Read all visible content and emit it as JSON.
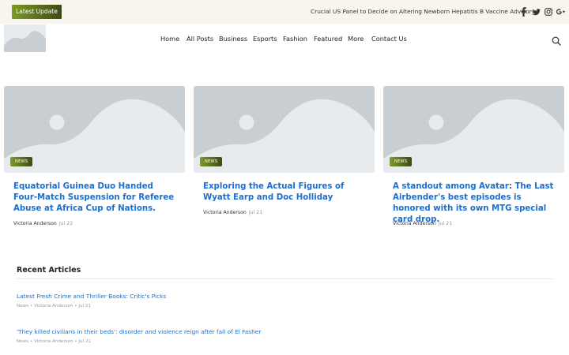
{
  "topbar": {
    "latest_label": "Latest Update",
    "ticker_text": "Crucial US Panel to Decide on Altering Newborn Hepatitis B Vaccine Advisory",
    "social": [
      "facebook-icon",
      "twitter-icon",
      "instagram-icon",
      "google-plus-icon"
    ]
  },
  "nav": {
    "items": [
      "Home",
      "All Posts",
      "Business",
      "Esports",
      "Fashion",
      "Featured",
      "More",
      "Contact Us"
    ]
  },
  "featured": [
    {
      "badge": "NEWS",
      "title": "Equatorial Guinea Duo Handed Four-Match Suspension for Referee Abuse at Africa Cup of Nations.",
      "author": "Victoria Anderson",
      "date": "Jul 22"
    },
    {
      "badge": "NEWS",
      "title": "Exploring the Actual Figures of Wyatt Earp and Doc Holliday",
      "author": "Victoria Anderson",
      "date": "Jul 21"
    },
    {
      "badge": "NEWS",
      "title": "A standout among Avatar: The Last Airbender's best episodes is honored with its own MTG special card drop.",
      "author": "Victoria Anderson",
      "date": "Jul 21"
    }
  ],
  "recent": {
    "title": "Recent Articles",
    "articles": [
      {
        "title": "Latest Fresh Crime and Thriller Books: Critic's Picks",
        "meta": "News • Victoria Anderson • Jul 21"
      },
      {
        "title": "'They killed civilians in their beds': disorder and violence reign after fall of El Fasher",
        "meta": "News • Victoria Anderson • Jul 21"
      }
    ]
  },
  "colors": {
    "accent_gradient_start": "#7d9a27",
    "accent_gradient_end": "#3e4a16",
    "link_blue": "#1a6fd0",
    "topbar_bg": "#f8f6ec",
    "placeholder_bg": "#c9ced3"
  }
}
